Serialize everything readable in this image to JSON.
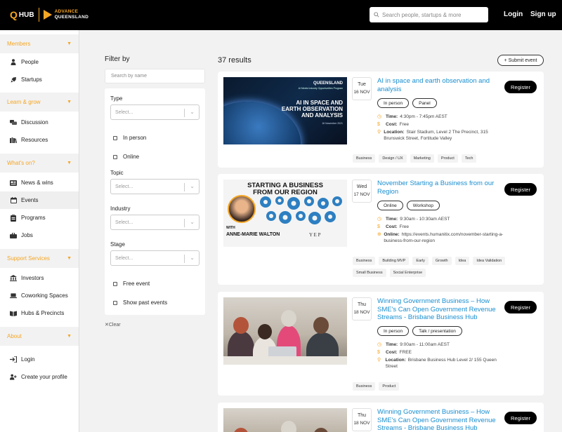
{
  "header": {
    "logo_q": "Q",
    "logo_hub": "HUB",
    "logo_advance": "ADVANCE",
    "logo_queensland": "QUEENSLAND",
    "search_placeholder": "Search people, startups & more",
    "login": "Login",
    "signup": "Sign up"
  },
  "sidebar": {
    "sections": [
      {
        "title": "Members",
        "items": [
          "People",
          "Startups"
        ]
      },
      {
        "title": "Learn & grow",
        "items": [
          "Discussion",
          "Resources"
        ]
      },
      {
        "title": "What's on?",
        "items": [
          "News & wins",
          "Events",
          "Programs",
          "Jobs"
        ]
      },
      {
        "title": "Support Services",
        "items": [
          "Investors",
          "Coworking Spaces",
          "Hubs & Precincts"
        ]
      },
      {
        "title": "About",
        "items": []
      }
    ],
    "bottom_items": [
      "Login",
      "Create your profile"
    ],
    "active_item": "Events"
  },
  "filter": {
    "title": "Filter by",
    "search_placeholder": "Search by name",
    "type_label": "Type",
    "select_placeholder": "Select...",
    "in_person": "In person",
    "online": "Online",
    "topic_label": "Topic",
    "industry_label": "Industry",
    "stage_label": "Stage",
    "free_event": "Free event",
    "show_past": "Show past events",
    "clear": "Clear"
  },
  "results": {
    "count": "37 results",
    "submit": "+ Submit event",
    "register": "Register",
    "events": [
      {
        "day": "Tue",
        "date": "16 NOV",
        "title": "AI in space and earth observation and analysis",
        "pills": [
          "In person",
          "Panel"
        ],
        "time_label": "Time:",
        "time": "4:30pm - 7:45pm AEST",
        "cost_label": "Cost:",
        "cost": "Free",
        "loc_label": "Location:",
        "location": "Stair Stadium, Level 2 The Precinct, 315 Brunswick Street, Fortitude Valley",
        "tags": [
          "Business",
          "Design / UX",
          "Marketing",
          "Product",
          "Tech"
        ],
        "image": {
          "brand": "QUEENSLAND",
          "sub": "AI Meets Industry Opportunities Program",
          "headline": "AI IN SPACE AND EARTH OBSERVATION AND ANALYSIS",
          "date": "16 November 2021"
        }
      },
      {
        "day": "Wed",
        "date": "17 NOV",
        "title": "November Starting a Business from our Region",
        "pills": [
          "Online",
          "Workshop"
        ],
        "time_label": "Time:",
        "time": "9:30am - 10:30am AEST",
        "cost_label": "Cost:",
        "cost": "Free",
        "loc_label": "Online:",
        "location": "https://events.humanitix.com/november-starting-a-business-from-our-region",
        "tags": [
          "Business",
          "Building MVP",
          "Early",
          "Growth",
          "Idea",
          "Idea Validation",
          "Small Business",
          "Social Enterprise"
        ],
        "image": {
          "headline1": "STARTING A BUSINESS",
          "headline2": "FROM OUR REGION",
          "with": "WITH",
          "name": "ANNE-MARIE WALTON",
          "logo": "Y E P"
        }
      },
      {
        "day": "Thu",
        "date": "18 NOV",
        "title": "Winning Government Business – How SME's Can Open Government Revenue Streams - Brisbane Business Hub",
        "pills": [
          "In person",
          "Talk / presentation"
        ],
        "time_label": "Time:",
        "time": "9:00am - 11:00am AEST",
        "cost_label": "Cost:",
        "cost": "FREE",
        "loc_label": "Location:",
        "location": "Brisbane Business Hub Level 2/ 155 Queen Street",
        "tags": [
          "Business",
          "Product"
        ]
      },
      {
        "day": "Thu",
        "date": "18 NOV",
        "title": "Winning Government Business – How SME's Can Open Government Revenue Streams - Brisbane Business Hub"
      }
    ]
  },
  "colors": {
    "accent": "#f5a623",
    "link": "#1a8fd0",
    "topbar": "#000000",
    "background": "#f2f2f3"
  }
}
